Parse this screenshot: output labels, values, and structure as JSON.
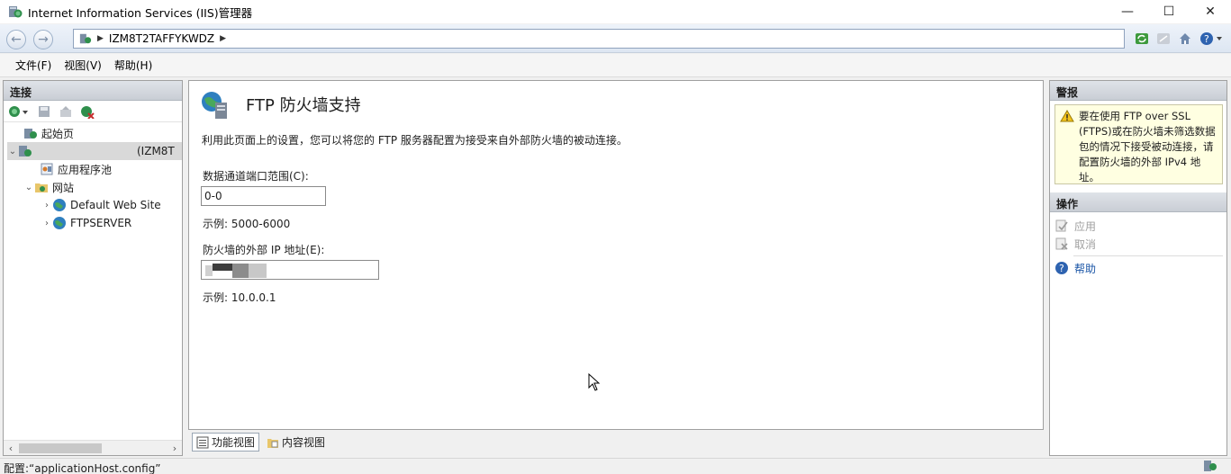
{
  "window": {
    "title": "Internet Information Services (IIS)管理器",
    "minimize_glyph": "—",
    "maximize_glyph": "☐",
    "close_glyph": "✕"
  },
  "address_bar": {
    "back_glyph": "←",
    "forward_glyph": "→",
    "crumbs": [
      "IZM8T2TAFFYKWDZ"
    ],
    "separator": "▶"
  },
  "menu": {
    "items": [
      "文件(F)",
      "视图(V)",
      "帮助(H)"
    ]
  },
  "connections": {
    "header": "连接",
    "tree": [
      {
        "label": "起始页",
        "indent": 0,
        "expander": "",
        "icon": "start-page-icon"
      },
      {
        "label": "(IZM8T",
        "indent": 0,
        "expander": "⌄",
        "icon": "server-icon",
        "selected": true
      },
      {
        "label": "应用程序池",
        "indent": 1,
        "expander": "",
        "icon": "app-pool-icon"
      },
      {
        "label": "网站",
        "indent": 1,
        "expander": "⌄",
        "icon": "sites-folder-icon"
      },
      {
        "label": "Default Web Site",
        "indent": 2,
        "expander": "›",
        "icon": "globe-icon"
      },
      {
        "label": "FTPSERVER",
        "indent": 2,
        "expander": "›",
        "icon": "globe-icon"
      }
    ],
    "scroll_left": "‹",
    "scroll_right": "›"
  },
  "feature": {
    "title": "FTP 防火墙支持",
    "description": "利用此页面上的设置，您可以将您的 FTP 服务器配置为接受来自外部防火墙的被动连接。",
    "port_range_label": "数据通道端口范围(C):",
    "port_range_value": "0-0",
    "port_range_example": "示例: 5000-6000",
    "external_ip_label": "防火墙的外部 IP 地址(E):",
    "external_ip_value": "",
    "external_ip_example": "示例: 10.0.0.1"
  },
  "view_tabs": {
    "features_view": "功能视图",
    "content_view": "内容视图"
  },
  "alerts": {
    "header": "警报",
    "message": "要在使用 FTP over SSL (FTPS)或在防火墙未筛选数据包的情况下接受被动连接，请配置防火墙的外部 IPv4 地址。"
  },
  "actions": {
    "header": "操作",
    "apply": "应用",
    "cancel": "取消",
    "help": "帮助"
  },
  "status": {
    "text": "配置:“applicationHost.config”"
  },
  "colors": {
    "accent": "#1a55a6",
    "alert_bg": "#ffffe1",
    "selected_row": "#d9d9d9"
  }
}
